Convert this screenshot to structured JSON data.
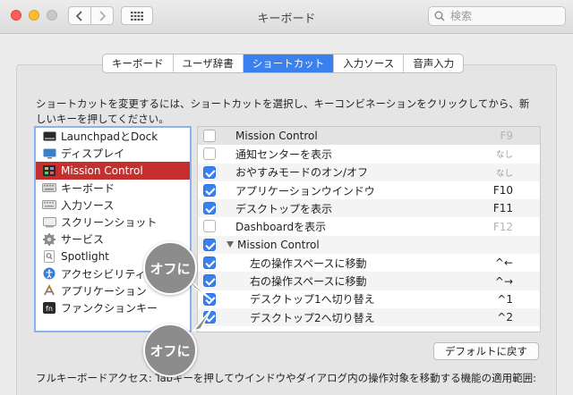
{
  "window": {
    "title": "キーボード"
  },
  "search": {
    "placeholder": "検索"
  },
  "tabs": [
    {
      "label": "キーボード",
      "active": false
    },
    {
      "label": "ユーザ辞書",
      "active": false
    },
    {
      "label": "ショートカット",
      "active": true
    },
    {
      "label": "入力ソース",
      "active": false
    },
    {
      "label": "音声入力",
      "active": false
    }
  ],
  "description": "ショートカットを変更するには、ショートカットを選択し、キーコンビネーションをクリックしてから、新しいキーを押してください。",
  "categories": [
    {
      "label": "LaunchpadとDock",
      "icon": "launchpad-dock-icon"
    },
    {
      "label": "ディスプレイ",
      "icon": "display-icon"
    },
    {
      "label": "Mission Control",
      "icon": "mission-control-icon",
      "selected": true
    },
    {
      "label": "キーボード",
      "icon": "keyboard-icon"
    },
    {
      "label": "入力ソース",
      "icon": "input-source-icon"
    },
    {
      "label": "スクリーンショット",
      "icon": "screenshot-icon"
    },
    {
      "label": "サービス",
      "icon": "services-gear-icon"
    },
    {
      "label": "Spotlight",
      "icon": "spotlight-icon"
    },
    {
      "label": "アクセシビリティ",
      "icon": "accessibility-icon"
    },
    {
      "label": "アプリケーション",
      "icon": "applications-icon"
    },
    {
      "label": "ファンクションキー",
      "icon": "function-key-icon"
    }
  ],
  "shortcuts": [
    {
      "label": "Mission Control",
      "key": "F9",
      "checked": false
    },
    {
      "label": "通知センターを表示",
      "key": "なし",
      "checked": false
    },
    {
      "label": "おやすみモードのオン/オフ",
      "key": "なし",
      "checked": true
    },
    {
      "label": "アプリケーションウインドウ",
      "key": "F10",
      "checked": true
    },
    {
      "label": "デスクトップを表示",
      "key": "F11",
      "checked": true
    },
    {
      "label": "Dashboardを表示",
      "key": "F12",
      "checked": false
    },
    {
      "label": "Mission Control",
      "key": "",
      "checked": true
    },
    {
      "label": "左の操作スペースに移動",
      "key": "^←",
      "checked": true
    },
    {
      "label": "右の操作スペースに移動",
      "key": "^→",
      "checked": true
    },
    {
      "label": "デスクトップ1へ切り替え",
      "key": "^1",
      "checked": true
    },
    {
      "label": "デスクトップ2へ切り替え",
      "key": "^2",
      "checked": true
    }
  ],
  "default_button": "デフォルトに戻す",
  "footer": "フルキーボードアクセス: Tabキーを押してウインドウやダイアログ内の操作対象を移動する機能の適用範囲:",
  "callouts": [
    "オフに",
    "オフに"
  ],
  "colors": {
    "accent": "#3b80ef",
    "selection": "#c5302f",
    "callout": "#8c8c8c"
  }
}
